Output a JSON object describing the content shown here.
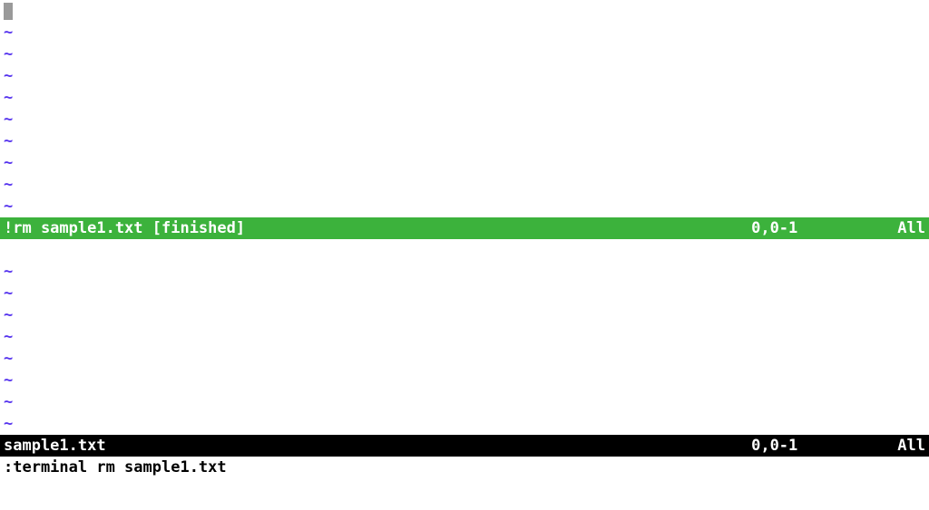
{
  "top_buffer": {
    "tilde": "~",
    "empty_lines": 9,
    "status": {
      "title": "!rm sample1.txt [finished]",
      "position": "0,0-1",
      "scroll": "All"
    }
  },
  "bottom_buffer": {
    "tilde": "~",
    "empty_lines_before": 1,
    "tilde_lines": 8,
    "status": {
      "title": "sample1.txt",
      "position": "0,0-1",
      "scroll": "All"
    }
  },
  "command_line": ":terminal rm sample1.txt"
}
